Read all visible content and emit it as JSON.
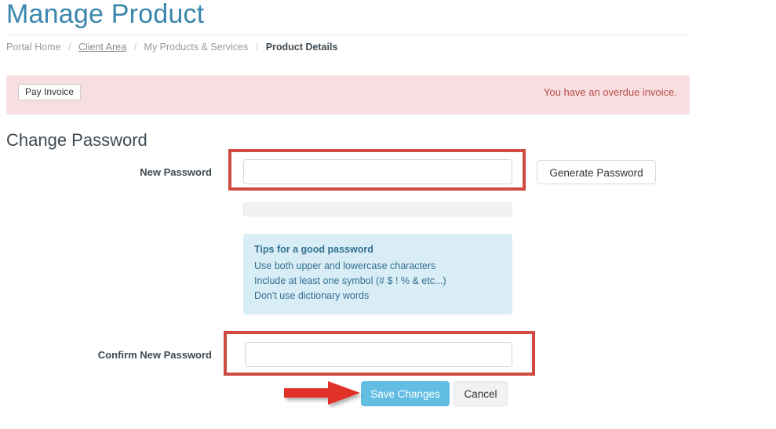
{
  "header": {
    "title": "Manage Product"
  },
  "breadcrumb": {
    "items": [
      {
        "label": "Portal Home",
        "state": "link"
      },
      {
        "label": "Client Area",
        "state": "hover"
      },
      {
        "label": "My Products & Services",
        "state": "link"
      },
      {
        "label": "Product Details",
        "state": "active"
      }
    ],
    "separator": "/"
  },
  "alert": {
    "button_label": "Pay Invoice",
    "message": "You have an overdue invoice.",
    "background_color": "#f7dfe1",
    "text_color": "#b94a48"
  },
  "main": {
    "section_title": "Change Password",
    "fields": {
      "new_password": {
        "label": "New Password",
        "value": "",
        "placeholder": ""
      },
      "confirm_password": {
        "label": "Confirm New Password",
        "value": "",
        "placeholder": ""
      }
    },
    "generate_button_label": "Generate Password",
    "strength": {
      "percent": 0
    },
    "tips": {
      "title": "Tips for a good password",
      "lines": [
        "Use both upper and lowercase characters",
        "Include at least one symbol (# $ ! % & etc...)",
        "Don't use dictionary words"
      ],
      "background_color": "#d9edf7",
      "text_color": "#31708f"
    },
    "actions": {
      "save_label": "Save Changes",
      "cancel_label": "Cancel",
      "save_color": "#62bde2"
    }
  },
  "annotations": {
    "color": "#cf4a42",
    "highlight_new_password": "red-box-around-new-password-field",
    "highlight_confirm_password": "red-box-around-confirm-password-field",
    "arrow_points_to": "Save Changes"
  }
}
